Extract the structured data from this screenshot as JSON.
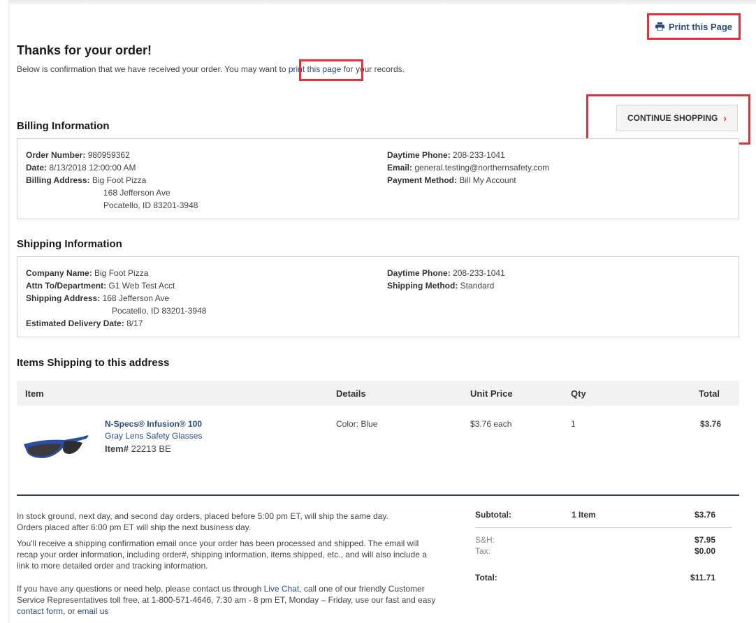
{
  "header": {
    "print_label": "Print this Page",
    "title": "Thanks for your order!",
    "intro_before": "Below is confirmation that we have received your order. You may want to ",
    "intro_link": "print this page",
    "intro_after": " for your records.",
    "continue_label": "CONTINUE SHOPPING"
  },
  "billing": {
    "section_title": "Billing Information",
    "order_number_label": "Order Number:",
    "order_number": "980959362",
    "date_label": "Date:",
    "date": "8/13/2018 12:00:00 AM",
    "address_label": "Billing Address:",
    "address_line1": "Big Foot Pizza",
    "address_line2": "168 Jefferson Ave",
    "address_line3": "Pocatello, ID 83201-3948",
    "phone_label": "Daytime Phone:",
    "phone": "208-233-1041",
    "email_label": "Email:",
    "email": "general.testing@northernsafety.com",
    "payment_label": "Payment Method:",
    "payment": "Bill My Account"
  },
  "shipping": {
    "section_title": "Shipping Information",
    "company_label": "Company Name:",
    "company": "Big Foot Pizza",
    "attn_label": "Attn To/Department:",
    "attn": "G1 Web Test Acct",
    "address_label": "Shipping Address:",
    "address_line1": "168 Jefferson Ave",
    "address_line2": "Pocatello, ID 83201-3948",
    "delivery_label": "Estimated Delivery Date:",
    "delivery": "8/17",
    "phone_label": "Daytime Phone:",
    "phone": "208-233-1041",
    "method_label": "Shipping Method:",
    "method": "Standard"
  },
  "items": {
    "section_title": "Items Shipping to this address",
    "columns": [
      "Item",
      "Details",
      "Unit Price",
      "Qty",
      "Total"
    ],
    "rows": [
      {
        "name": "N-Specs® Infusion® 100",
        "subtitle": "Gray Lens Safety Glasses",
        "item_label": "Item#",
        "item_number": "22213 BE",
        "details": "Color: Blue",
        "unit_price": "$3.76 each",
        "qty": "1",
        "total": "$3.76"
      }
    ]
  },
  "notes": {
    "ship_note_1": "In stock ground, next day, and second day orders, placed before 5:00 pm ET, will ship the same day.",
    "ship_note_2": "Orders placed after 6:00 pm ET will ship the next business day.",
    "confirm_note": "You'll receive a shipping confirmation email once your order has been processed and shipped. The email will recap your order information, including order#, shipping information, items shipped, etc., and will also include a link to more detailed order and tracking information.",
    "help_before": "If you have any questions or need help, please contact us through ",
    "help_chat": "Live Chat",
    "help_middle": ", call one of our friendly Customer Service Representatives toll free, at 1-800-571-4646, 7:30 am - 8 pm ET, Monday – Friday, use our fast and easy ",
    "help_form": "contact form",
    "help_or": ", or ",
    "help_email": "email us"
  },
  "totals": {
    "subtotal_label": "Subtotal:",
    "subtotal_items": "1 Item",
    "subtotal": "$3.76",
    "sh_label": "S&H:",
    "sh": "$7.95",
    "tax_label": "Tax:",
    "tax": "$0.00",
    "total_label": "Total:",
    "total": "$11.71"
  },
  "colors": {
    "link": "#2a4d80",
    "highlight": "#e0313b",
    "divider": "#2b3a4e"
  }
}
